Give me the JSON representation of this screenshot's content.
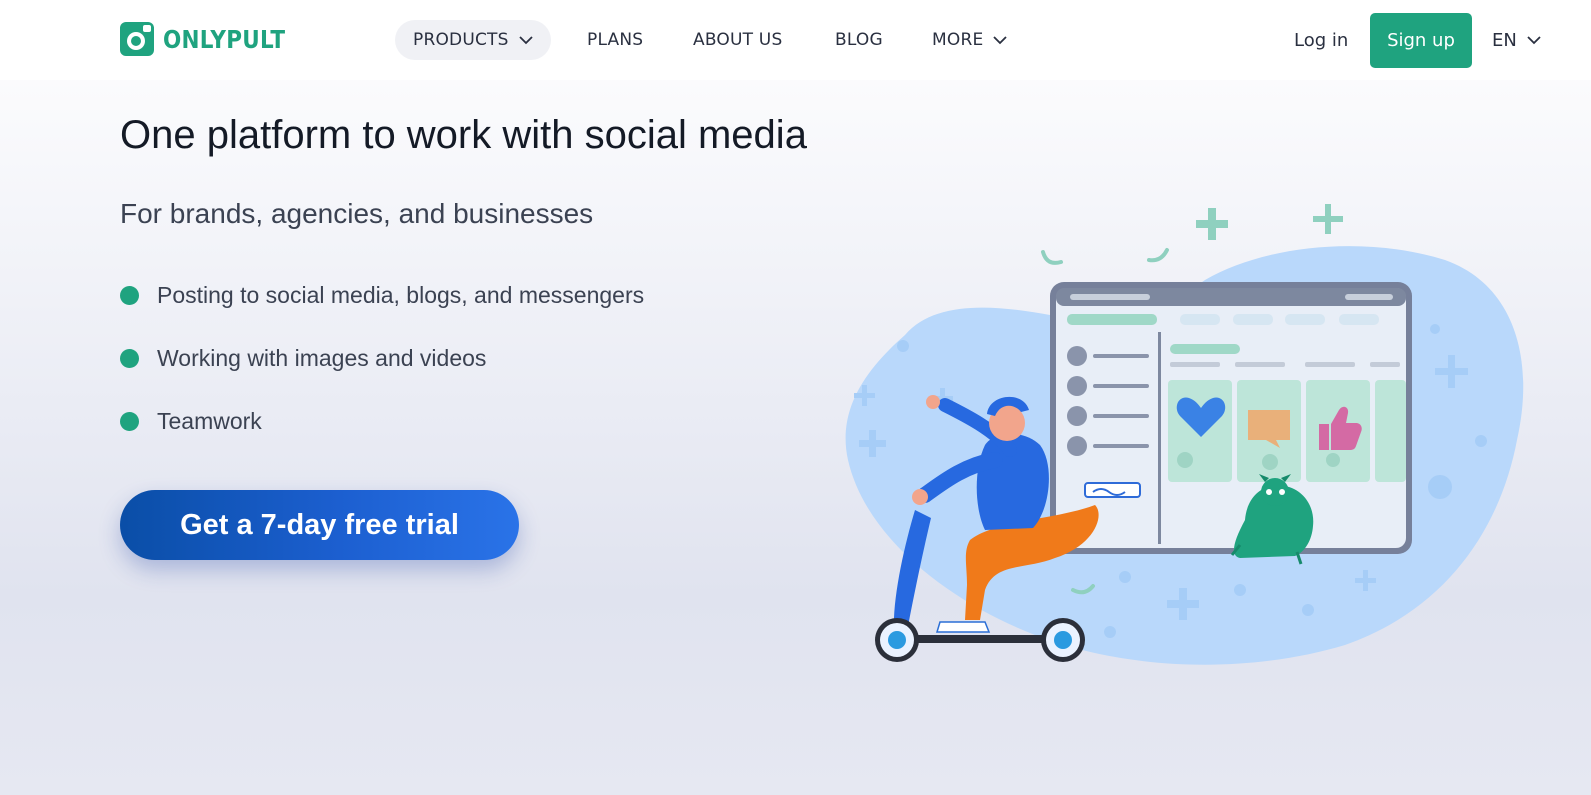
{
  "header": {
    "logo_text": "ONLYPULT",
    "nav": [
      {
        "label": "PRODUCTS",
        "has_dropdown": true,
        "active": true
      },
      {
        "label": "PLANS",
        "has_dropdown": false
      },
      {
        "label": "ABOUT US",
        "has_dropdown": false
      },
      {
        "label": "BLOG",
        "has_dropdown": false
      },
      {
        "label": "MORE",
        "has_dropdown": true
      }
    ],
    "login_label": "Log in",
    "signup_label": "Sign up",
    "language": "EN"
  },
  "hero": {
    "title": "One platform to work with social media",
    "subtitle": "For brands, agencies, and businesses",
    "features": [
      "Posting to social media, blogs, and messengers",
      "Working with images and videos",
      "Teamwork"
    ],
    "cta_label": "Get a 7-day free trial"
  },
  "colors": {
    "brand": "#1fa37f",
    "cta": "#0a4ea7",
    "blob": "#b9d8fb"
  },
  "icons": [
    "logo-camera-icon",
    "chevron-down-icon",
    "heart-icon",
    "comment-icon",
    "thumbs-up-icon"
  ]
}
